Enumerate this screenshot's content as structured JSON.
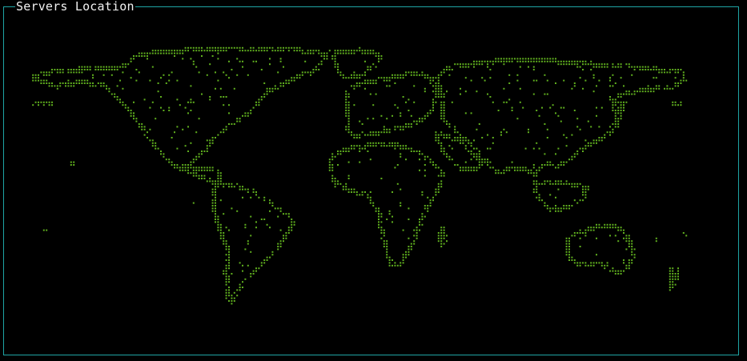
{
  "panel": {
    "title": "Servers Location"
  },
  "colors": {
    "background": "#000000",
    "border": "#1fa5a5",
    "title": "#f2f2f2",
    "map_dots": "#5fae1e"
  }
}
